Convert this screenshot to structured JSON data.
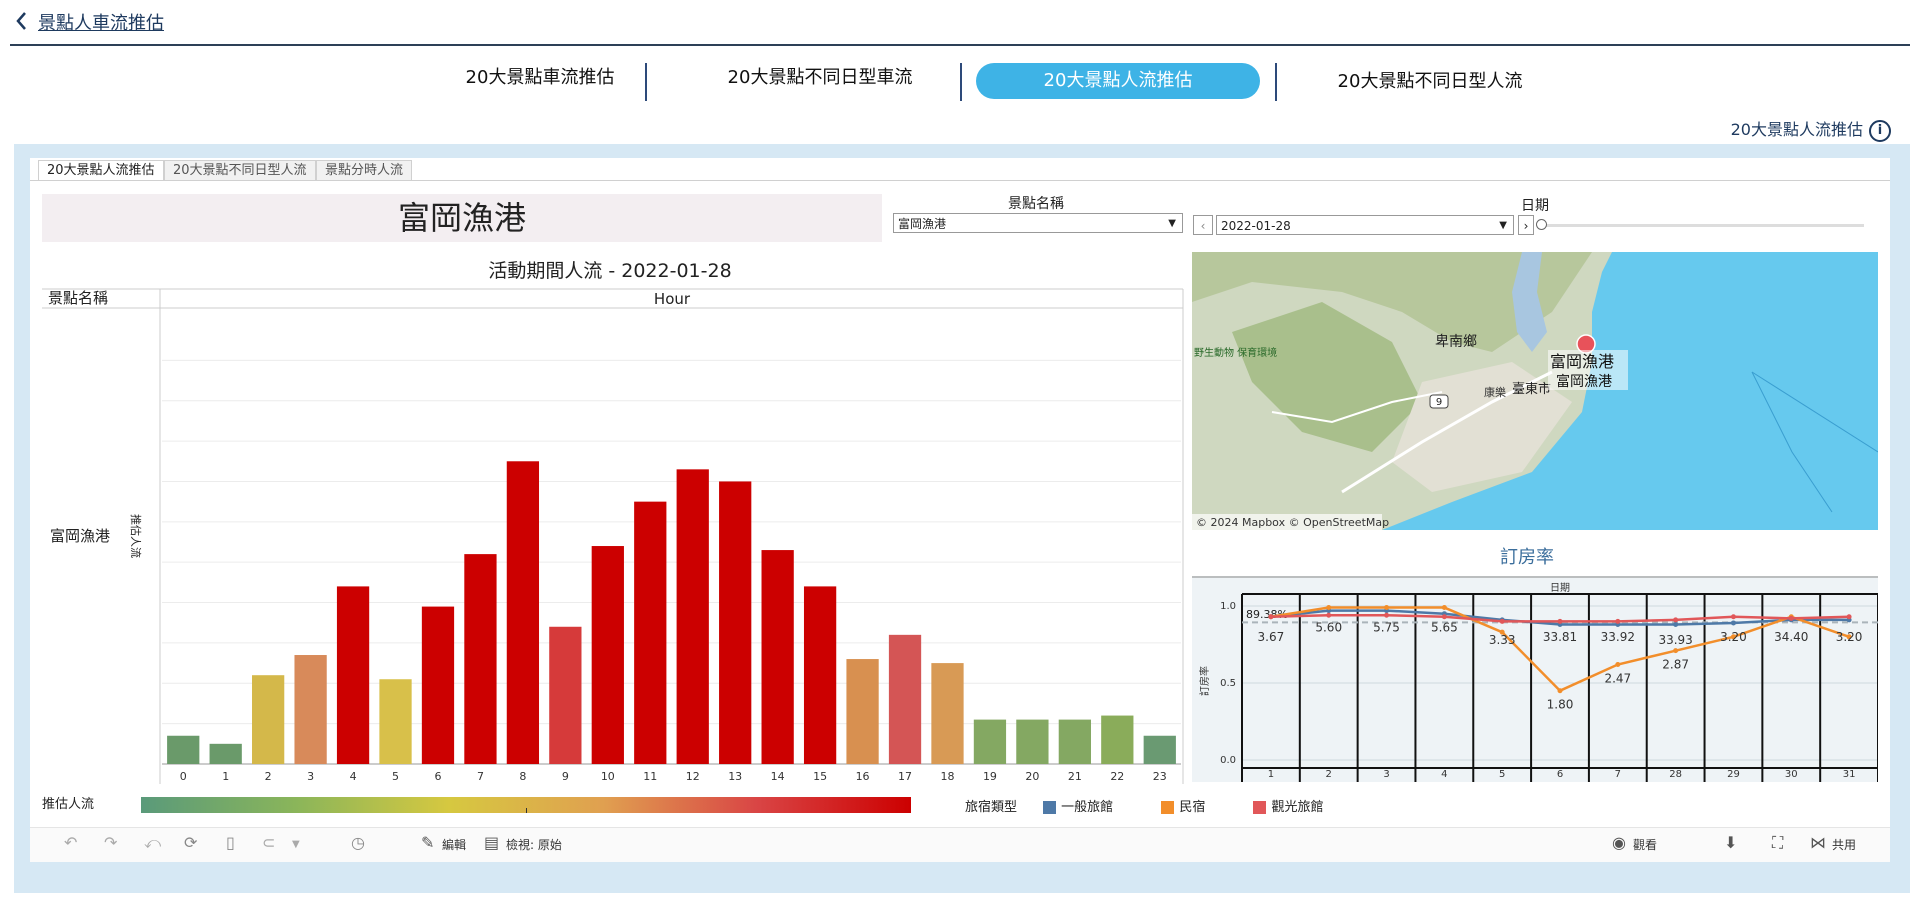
{
  "header": {
    "title": "景點人車流推估"
  },
  "top_tabs": [
    {
      "label": "20大景點車流推估",
      "active": false
    },
    {
      "label": "20大景點不同日型車流",
      "active": false
    },
    {
      "label": "20大景點人流推估",
      "active": true
    },
    {
      "label": "20大景點不同日型人流",
      "active": false
    }
  ],
  "info": {
    "label": "20大景點人流推估",
    "icon": "info-icon"
  },
  "sub_tabs": [
    "20大景點人流推估",
    "20大景點不同日型人流",
    "景點分時人流"
  ],
  "spot_title": "富岡漁港",
  "filters": {
    "spot_label": "景點名稱",
    "spot_value": "富岡漁港",
    "date_label": "日期",
    "date_value": "2022-01-28"
  },
  "chart_data": [
    {
      "type": "bar",
      "title": "活動期間人流 - 2022-01-28",
      "row_header": "景點名稱",
      "column_header": "Hour",
      "row_label": "富岡漁港",
      "ylabel": "推估人流",
      "categories": [
        "0",
        "1",
        "2",
        "3",
        "4",
        "5",
        "6",
        "7",
        "8",
        "9",
        "10",
        "11",
        "12",
        "13",
        "14",
        "15",
        "16",
        "17",
        "18",
        "19",
        "20",
        "21",
        "22",
        "23"
      ],
      "values": [
        7,
        5,
        22,
        27,
        44,
        21,
        39,
        52,
        75,
        34,
        54,
        65,
        73,
        70,
        53,
        44,
        26,
        32,
        25,
        11,
        11,
        11,
        12,
        7
      ],
      "colors": [
        "#6a9a6a",
        "#6a9a6a",
        "#d4b84a",
        "#d88a5a",
        "#cc0000",
        "#d8c04a",
        "#cc0000",
        "#cc0000",
        "#cc0000",
        "#d63a3a",
        "#cc0000",
        "#cc0000",
        "#cc0000",
        "#cc0000",
        "#cc0000",
        "#cc0000",
        "#d89050",
        "#d45555",
        "#d89a55",
        "#84a862",
        "#84a862",
        "#84a862",
        "#8aac5a",
        "#6a9a72"
      ],
      "ylim": [
        0,
        110
      ],
      "grid": true
    },
    {
      "type": "line",
      "title": "訂房率",
      "column_header": "日期",
      "ylabel": "訂房率",
      "categories": [
        "1",
        "2",
        "3",
        "4",
        "5",
        "6",
        "7",
        "28",
        "29",
        "30",
        "31"
      ],
      "yticks": [
        "1.0",
        "0.5",
        "0.0"
      ],
      "ylim": [
        0,
        1.0
      ],
      "reference_label": "89.38%",
      "reference_value": 0.8938,
      "series": [
        {
          "name": "一般旅館",
          "color": "#4e79a7",
          "values": [
            0.93,
            0.97,
            0.97,
            0.95,
            0.91,
            0.88,
            0.88,
            0.88,
            0.89,
            0.91,
            0.91
          ]
        },
        {
          "name": "民宿",
          "color": "#f28e2b",
          "values": [
            0.93,
            0.99,
            0.99,
            0.99,
            0.83,
            0.45,
            0.62,
            0.71,
            0.8,
            0.93,
            0.8
          ]
        },
        {
          "name": "觀光旅館",
          "color": "#e15759",
          "values": [
            0.93,
            0.94,
            0.94,
            0.93,
            0.9,
            0.9,
            0.9,
            0.91,
            0.93,
            0.92,
            0.93
          ]
        }
      ],
      "data_labels": [
        "3.67",
        "5.60",
        "5.75",
        "5.65",
        "3.33",
        "33.81",
        "33.92",
        "33.93",
        "3.20",
        "34.40",
        "3.20"
      ],
      "minmax_labels": {
        "min": "1.80",
        "after_min": "2.47",
        "mid": "2.87"
      }
    }
  ],
  "map": {
    "labels": [
      "卑南鄉",
      "臺東市",
      "康樂",
      "富岡漁港",
      "富岡漁港"
    ],
    "left_label": "野生動物 保育環境",
    "road_shield": "9",
    "attribution": "© 2024 Mapbox  © OpenStreetMap"
  },
  "legend": {
    "gradient_label": "推估人流",
    "lodge_type_label": "旅宿類型",
    "items": [
      {
        "name": "一般旅館",
        "color": "#4e79a7"
      },
      {
        "name": "民宿",
        "color": "#f28e2b"
      },
      {
        "name": "觀光旅館",
        "color": "#e15759"
      }
    ]
  },
  "toolbar": {
    "edit": "編輯",
    "view": "檢視: 原始",
    "watch": "觀看",
    "share": "共用"
  }
}
